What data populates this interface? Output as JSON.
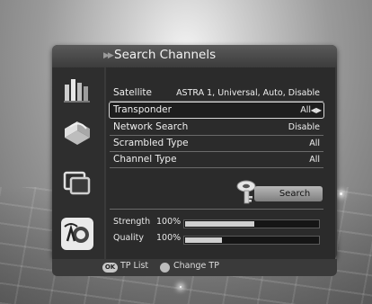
{
  "window": {
    "title": "Search Channels"
  },
  "settings": [
    {
      "label": "Satellite",
      "value": "ASTRA 1, Universal, Auto, Disable",
      "selected": false
    },
    {
      "label": "Transponder",
      "value": "All",
      "selected": true
    },
    {
      "label": "Network Search",
      "value": "Disable",
      "selected": false
    },
    {
      "label": "Scrambled Type",
      "value": "All",
      "selected": false
    },
    {
      "label": "Channel Type",
      "value": "All",
      "selected": false
    }
  ],
  "search_button": {
    "label": "Search"
  },
  "signal": {
    "strength": {
      "label": "Strength",
      "percent_text": "100%",
      "level": 0.52
    },
    "quality": {
      "label": "Quality",
      "percent_text": "100%",
      "level": 0.28
    }
  },
  "footer": {
    "ok_key": "OK",
    "ok_action": "TP List",
    "nav_action": "Change TP"
  },
  "icons": [
    "channel-list-icon",
    "satellite-dish-icon",
    "screen-icon",
    "tv-antenna-icon",
    "key-icon",
    "left-right-arrow-icon"
  ]
}
